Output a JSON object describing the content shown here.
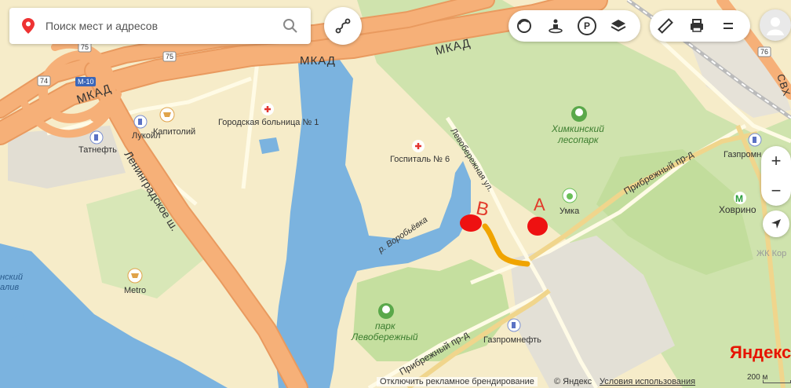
{
  "search": {
    "placeholder": "Поиск мест и адресов"
  },
  "controls": {
    "route": "route-icon",
    "traffic": "traffic-icon",
    "panorama": "panorama-icon",
    "parking_label": "P",
    "layers": "layers-icon",
    "ruler": "ruler-icon",
    "print": "print-icon",
    "menu": "menu-icon",
    "zoom_in": "+",
    "zoom_out": "−",
    "locate": "locate-icon"
  },
  "roads": {
    "mkad_left": "МКАД",
    "mkad_mid": "МКАД",
    "mkad_right": "МКАД",
    "leningradskoe": "Ленинградское ш.",
    "levoberezhnaya": "Левобережная ул.",
    "pribrezhny_upper": "Прибрежный пр-д",
    "pribrezhny_lower": "Прибрежный пр-д",
    "shield_m10": "М-10",
    "shield_74": "74",
    "shield_75a": "75",
    "shield_75b": "75",
    "shield_76": "76",
    "svh": "СВХ"
  },
  "river": {
    "name": "р. Воробьёвка"
  },
  "places": {
    "kapitoliy": "Капитолий",
    "lukoil": "Лукойл",
    "tatneft": "Татнефть",
    "hospital1": "Городская больница № 1",
    "gospital6": "Госпиталь № 6",
    "khimki_park_1": "Химкинский",
    "khimki_park_2": "лесопарк",
    "umka": "Умка",
    "gazprom_top": "Газпромн",
    "khovrino": "Ховрино",
    "jk": "ЖК Кор",
    "metro_shop": "Metro",
    "park_lev_1": "парк",
    "park_lev_2": "Левобережный",
    "gazpromneft": "Газпромнефть",
    "left_water_1": "нский",
    "left_water_2": "алив"
  },
  "annotations": {
    "point_a": "A",
    "point_b": "B"
  },
  "footer": {
    "disable_ad": "Отключить рекламное брендирование",
    "copyright": "© Яндекс",
    "terms": "Условия использования",
    "scale": "200 м",
    "logo": "Яндекс"
  },
  "colors": {
    "land": "#f6ecc9",
    "water": "#7bb3df",
    "park": "#c7e0a5",
    "highway": "#f6b078",
    "highway_edge": "#e99a5f",
    "road": "#fff7d6",
    "annotation_red": "#ee1111",
    "route_orange": "#f0a400"
  }
}
